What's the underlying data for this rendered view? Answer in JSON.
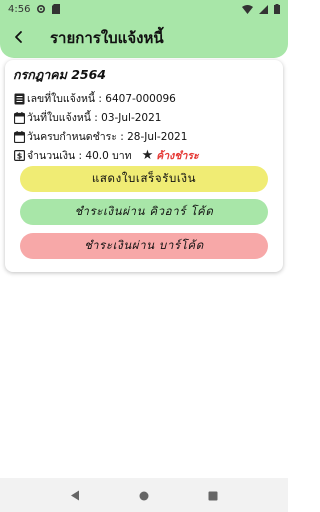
{
  "status_bar": {
    "time": "4:56"
  },
  "app_bar": {
    "title": "รายการใบแจ้งหนี้"
  },
  "invoice": {
    "month_label": "กรกฎาคม 2564",
    "invoice_no_label": "เลขที่ใบแจ้งหนี้ : 6407-000096",
    "invoice_date_label": "วันที่ใบแจ้งหนี้ : 03-Jul-2021",
    "due_date_label": "วันครบกำหนดชำระ : 28-Jul-2021",
    "amount_label": "จำนวนเงิน : 40.0 บาท",
    "status_label": "ค้างชำระ"
  },
  "actions": {
    "receipt_label": "แสดงใบเสร็จรับเงิน",
    "qr_pay_label": "ชำระเงินผ่าน คิวอาร์ โค้ด",
    "barcode_pay_label": "ชำระเงินผ่าน บาร์โค้ด"
  },
  "icons": {
    "back": "back-arrow-icon",
    "invoice_no": "document-icon",
    "invoice_date": "calendar-icon",
    "due_date": "calendar-icon",
    "amount": "money-icon",
    "status": "star-icon"
  },
  "colors": {
    "header": "#a8e6a8",
    "receipt_button": "#f0ec74",
    "qr_button": "#a8e6a8",
    "barcode_button": "#f7a8a8",
    "overdue_text": "#e53935"
  }
}
